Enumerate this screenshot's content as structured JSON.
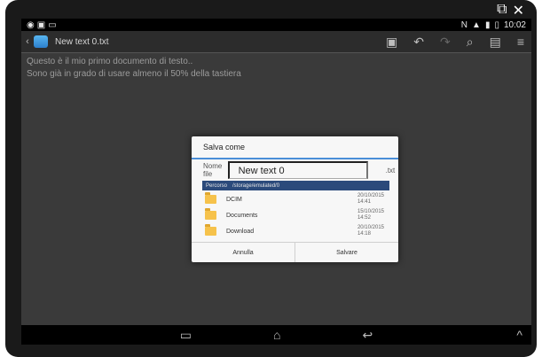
{
  "statusbar": {
    "left_icons": [
      "eye-icon",
      "screen-icon",
      "cast-icon"
    ],
    "right_icons": [
      "nfc-icon",
      "wifi-icon",
      "signal-icon",
      "battery-icon"
    ],
    "time": "10:02"
  },
  "top_corner": {
    "icons": [
      "external-window-icon",
      "close-icon"
    ],
    "glyphs": [
      "⧉",
      "✕"
    ]
  },
  "actionbar": {
    "title": "New text 0.txt",
    "tools": [
      "save-icon",
      "undo-icon",
      "redo-icon",
      "find-icon",
      "copy-icon",
      "menu-icon"
    ],
    "tool_glyphs": [
      "▣",
      "↶",
      "↷",
      "⌕",
      "▤",
      "≡"
    ]
  },
  "editor": {
    "lines": [
      "Questo è il mio primo documento di testo..",
      "Sono già in grado di usare almeno il 50% della tastiera"
    ]
  },
  "dialog": {
    "title": "Salva come",
    "filename_label": "Nome file",
    "filename_value": "New text 0",
    "extension": ".txt",
    "path_label": "Percorso",
    "path_value": "/storage/emulated/0",
    "folders": [
      {
        "name": "DCIM",
        "date": "20/10/2015",
        "time": "14:41"
      },
      {
        "name": "Documents",
        "date": "15/10/2015",
        "time": "14:52"
      },
      {
        "name": "Download",
        "date": "20/10/2015",
        "time": "14:18"
      }
    ],
    "cancel_label": "Annulla",
    "save_label": "Salvare"
  },
  "navbar": {
    "icons": [
      "recent-apps-icon",
      "home-icon",
      "back-icon",
      "chevron-up-icon"
    ],
    "glyphs": [
      "▭",
      "⌂",
      "↩",
      "^"
    ]
  }
}
